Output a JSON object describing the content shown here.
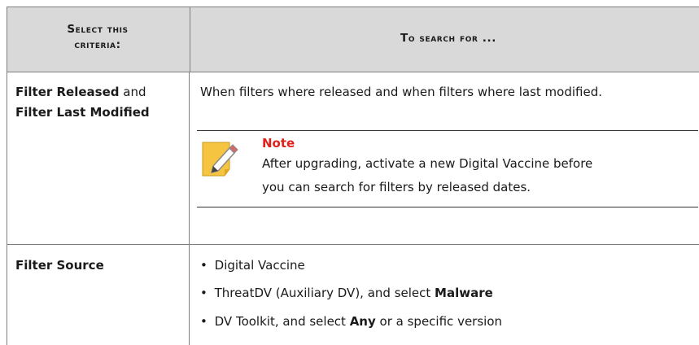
{
  "table": {
    "headers": [
      "Select this criteria:",
      "To search for ..."
    ],
    "header_lines": {
      "col1_line1": "Select this",
      "col1_line2": "criteria:"
    },
    "rows": [
      {
        "criteria_part1": "Filter Released",
        "criteria_joiner": " and",
        "criteria_part2": "Filter Last Modified",
        "description": "When filters where released and when filters where last modified.",
        "note": {
          "title": "Note",
          "line1": "After upgrading, activate a new Digital Vaccine before",
          "line2": "you can search for filters by released dates.",
          "icon": "note-pencil-icon"
        }
      },
      {
        "criteria": "Filter Source",
        "bullets": [
          {
            "text": "Digital Vaccine"
          },
          {
            "prefix": "ThreatDV (Auxiliary DV), and select ",
            "bold": "Malware",
            "suffix": ""
          },
          {
            "prefix": "DV Toolkit, and select ",
            "bold": "Any",
            "suffix": " or a specific version"
          }
        ],
        "bullet_glyph": "•"
      }
    ]
  },
  "colors": {
    "header_bg": "#d9d9d9",
    "border": "#7f7f7f",
    "note_title": "#e0201b",
    "note_icon": "#f5c542"
  }
}
